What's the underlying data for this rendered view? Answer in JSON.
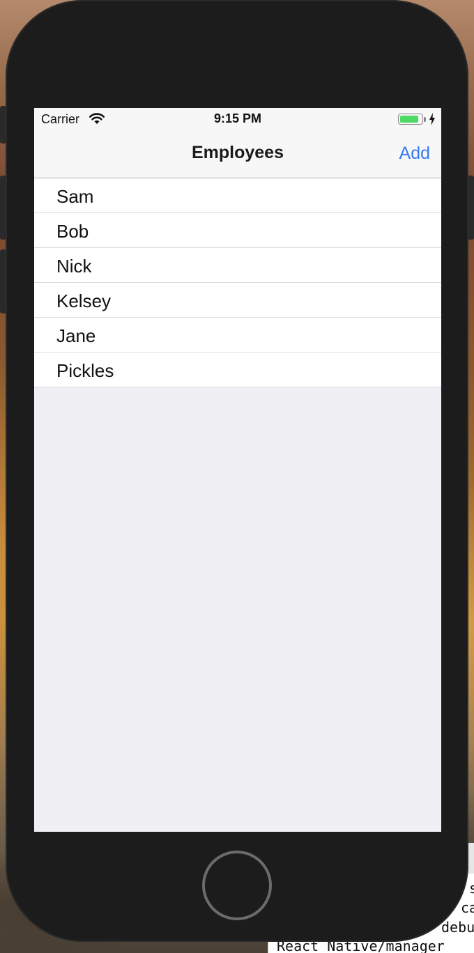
{
  "status_bar": {
    "carrier": "Carrier",
    "time": "9:15 PM",
    "battery_level": 0.9,
    "icons": [
      "wifi-icon",
      "battery-icon",
      "charging-icon"
    ]
  },
  "nav": {
    "title": "Employees",
    "add_label": "Add"
  },
  "employees": [
    {
      "name": "Sam"
    },
    {
      "name": "Bob"
    },
    {
      "name": "Nick"
    },
    {
      "name": "Kelsey"
    },
    {
      "name": "Jane"
    },
    {
      "name": "Pickles"
    }
  ],
  "terminal": {
    "lines": [
      "s",
      "ca",
      "debu",
      "React_Native/manager"
    ]
  },
  "colors": {
    "accent": "#3478f6",
    "battery": "#4cd964",
    "screen_background": "#efeff4",
    "device_body": "#1c1c1d"
  }
}
